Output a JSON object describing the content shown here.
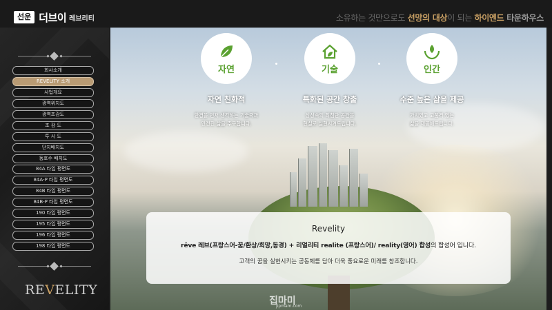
{
  "brand": {
    "badge": "선운",
    "name": "더브이",
    "sub": "레브리티"
  },
  "slogan": {
    "part1": "소유하는 것만으로도 ",
    "part2": "선망의 대상",
    "part3": "이 되는 ",
    "part4": "하이엔드 ",
    "part5": "타운하우스"
  },
  "sidebar": {
    "items": [
      {
        "label": "회사소개",
        "active": false
      },
      {
        "label": "REVELITY 소개",
        "active": true
      },
      {
        "label": "사업개요",
        "active": false
      },
      {
        "label": "광역위치도",
        "active": false
      },
      {
        "label": "광역조감도",
        "active": false
      },
      {
        "label": "조 감 도",
        "active": false
      },
      {
        "label": "투 시 도",
        "active": false
      },
      {
        "label": "단지배치도",
        "active": false
      },
      {
        "label": "동호수 배치도",
        "active": false
      },
      {
        "label": "84A 타입 평면도",
        "active": false
      },
      {
        "label": "84A-P 타입 평면도",
        "active": false
      },
      {
        "label": "84B 타입 평면도",
        "active": false
      },
      {
        "label": "84B-P 타입 평면도",
        "active": false
      },
      {
        "label": "190 타입 평면도",
        "active": false
      },
      {
        "label": "195 타입 평면도",
        "active": false
      },
      {
        "label": "196 타입 평면도",
        "active": false
      },
      {
        "label": "198 타입 평면도",
        "active": false
      }
    ],
    "logo_left": "RE",
    "logo_v": "V",
    "logo_right": "ELITY"
  },
  "features": [
    {
      "icon": "leaf-icon",
      "circle_label": "자연",
      "title": "자연 친화적",
      "desc1": "환경을 먼저 생각하는 기술력과",
      "desc2": "안전한 삶을 추구합니다."
    },
    {
      "icon": "house-leaf-icon",
      "circle_label": "기술",
      "title": "특화된 공간 창출",
      "desc1": "상상속의 최첨단 공간을",
      "desc2": "현실로 실현시켜드립니다."
    },
    {
      "icon": "hands-leaf-icon",
      "circle_label": "인간",
      "title": "수준 높은 삶을 제공",
      "desc1": "가치있고 고품격 있는",
      "desc2": "삶을 제공해드립니다."
    }
  ],
  "info": {
    "name": "Revelity",
    "line1_bold": "rêve 레브(프랑스어-꿈/환상/희망,동경) + 리얼리티 realite (프랑스어)/ reality(영어) 합성",
    "line1_rest": "의 합성어 입니다.",
    "line2": "고객의 꿈을 실현시키는 공동체를 담아 더욱 풍요로운 미래를 창조합니다."
  },
  "watermark": {
    "main": "집마미",
    "sub": "jipmam.com"
  },
  "colors": {
    "accent_gold": "#c9a064",
    "icon_green": "#5aa130",
    "active_menu": "#b99b74"
  }
}
